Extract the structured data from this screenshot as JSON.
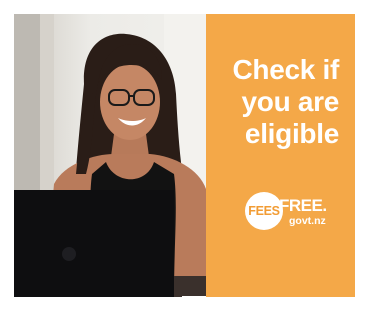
{
  "ad": {
    "headline": [
      "Check if",
      "you are",
      "eligible"
    ],
    "logo": {
      "circle_text": "FEES",
      "word": "FREE.",
      "url": "govt.nz"
    },
    "colors": {
      "accent": "#f4a848",
      "logo_text": "#f29c34"
    }
  }
}
